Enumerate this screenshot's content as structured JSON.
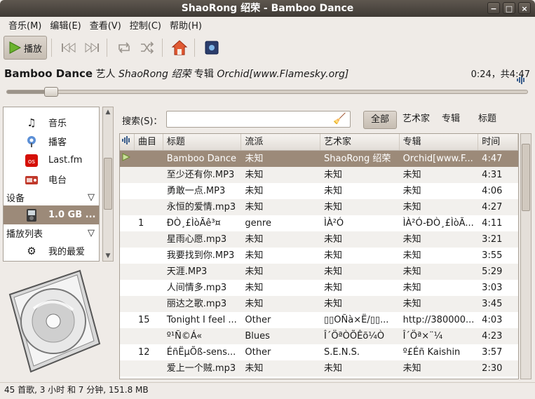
{
  "window": {
    "title": "ShaoRong 绍荣 - Bamboo Dance",
    "controls": [
      "−",
      "□",
      "×"
    ]
  },
  "menu": [
    "音乐(M)",
    "编辑(E)",
    "查看(V)",
    "控制(C)",
    "帮助(H)"
  ],
  "toolbar": {
    "play_label": "播放"
  },
  "now_playing": {
    "title": "Bamboo Dance",
    "artist_prefix": "艺人",
    "artist": "ShaoRong 绍荣",
    "album_prefix": "专辑",
    "album": "Orchid[www.Flamesky.org]",
    "time": "0:24，共4:47",
    "progress": 0.085
  },
  "sidebar": {
    "items": [
      {
        "icon": "music-note-icon",
        "label": "音乐"
      },
      {
        "icon": "podcast-icon",
        "label": "播客"
      },
      {
        "icon": "lastfm-icon",
        "label": "Last.fm"
      },
      {
        "icon": "radio-icon",
        "label": "电台"
      }
    ],
    "devices_header": "设备",
    "device": "1.0 GB ...",
    "playlists_header": "播放列表",
    "playlist_item": "我的最爱"
  },
  "search": {
    "label": "搜索(S)：",
    "value": ""
  },
  "filters": [
    "全部",
    "艺术家",
    "专辑",
    "标题"
  ],
  "columns": [
    "曲目",
    "标题",
    "流派",
    "艺术家",
    "专辑",
    "时间"
  ],
  "tracks": [
    {
      "n": "",
      "title": "Bamboo Dance",
      "genre": "未知",
      "artist": "ShaoRong 绍荣",
      "album": "Orchid[www.F...",
      "time": "4:47",
      "playing": true
    },
    {
      "n": "",
      "title": "至少还有你.MP3",
      "genre": "未知",
      "artist": "未知",
      "album": "未知",
      "time": "4:31"
    },
    {
      "n": "",
      "title": "勇敢一点.MP3",
      "genre": "未知",
      "artist": "未知",
      "album": "未知",
      "time": "4:06"
    },
    {
      "n": "",
      "title": "永恒的爱情.mp3",
      "genre": "未知",
      "artist": "未知",
      "album": "未知",
      "time": "4:27"
    },
    {
      "n": "1",
      "title": "ÐÒ¸£ÌòÃê³¤",
      "genre": "genre",
      "artist": "ÌÀ²Ó",
      "album": "ÌÀ²Ó-ÐÒ¸£ÌòÃ...",
      "time": "4:11"
    },
    {
      "n": "",
      "title": "星雨心愿.mp3",
      "genre": "未知",
      "artist": "未知",
      "album": "未知",
      "time": "3:21"
    },
    {
      "n": "",
      "title": "我要找到你.MP3",
      "genre": "未知",
      "artist": "未知",
      "album": "未知",
      "time": "3:55"
    },
    {
      "n": "",
      "title": "天涯.MP3",
      "genre": "未知",
      "artist": "未知",
      "album": "未知",
      "time": "5:29"
    },
    {
      "n": "",
      "title": "人间情多.mp3",
      "genre": "未知",
      "artist": "未知",
      "album": "未知",
      "time": "3:03"
    },
    {
      "n": "",
      "title": "丽达之歌.mp3",
      "genre": "未知",
      "artist": "未知",
      "album": "未知",
      "time": "3:45"
    },
    {
      "n": "15",
      "title": "Tonight I feel ...",
      "genre": "Other",
      "artist": "▯▯OÑà×Ë/▯▯...",
      "album": "http://380000...",
      "time": "4:03"
    },
    {
      "n": "",
      "title": "º¹Ñ©Á«",
      "genre": "Blues",
      "artist": "Î´ÖªÒÕÊõ¼Ò",
      "album": "Î´Öª×¨¼",
      "time": "4:23"
    },
    {
      "n": "12",
      "title": "ÉñËµÕß-sens...",
      "genre": "Other",
      "artist": "S.E.N.S.",
      "album": "º£Éñ Kaishin",
      "time": "3:57"
    },
    {
      "n": "",
      "title": "爱上一个贼.mp3",
      "genre": "未知",
      "artist": "未知",
      "album": "未知",
      "time": "2:30"
    }
  ],
  "status": "45 首歌, 3 小时 和 7 分钟, 151.8 MB"
}
